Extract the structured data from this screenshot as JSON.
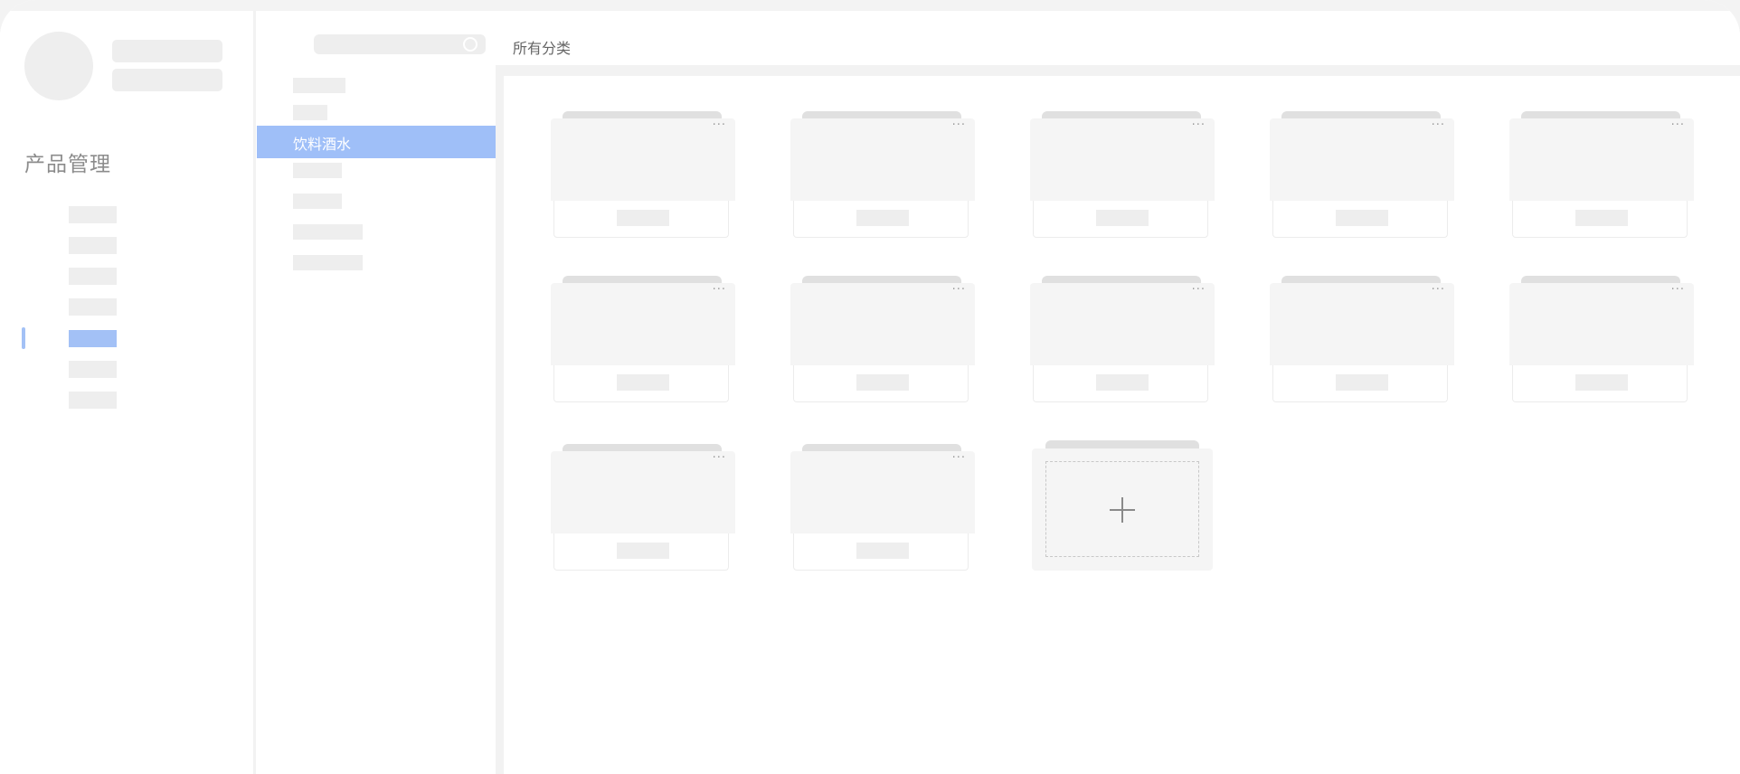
{
  "sidebar": {
    "module_title": "产品管理",
    "accent_color": "#a3c1f6",
    "nav_count": 7,
    "active_nav_index": 4
  },
  "category_panel": {
    "search": {
      "icon": "search-icon"
    },
    "active_category": "饮料酒水"
  },
  "main": {
    "breadcrumb": "所有分类",
    "more_icon_label": "···",
    "add_icon": "plus-icon"
  }
}
